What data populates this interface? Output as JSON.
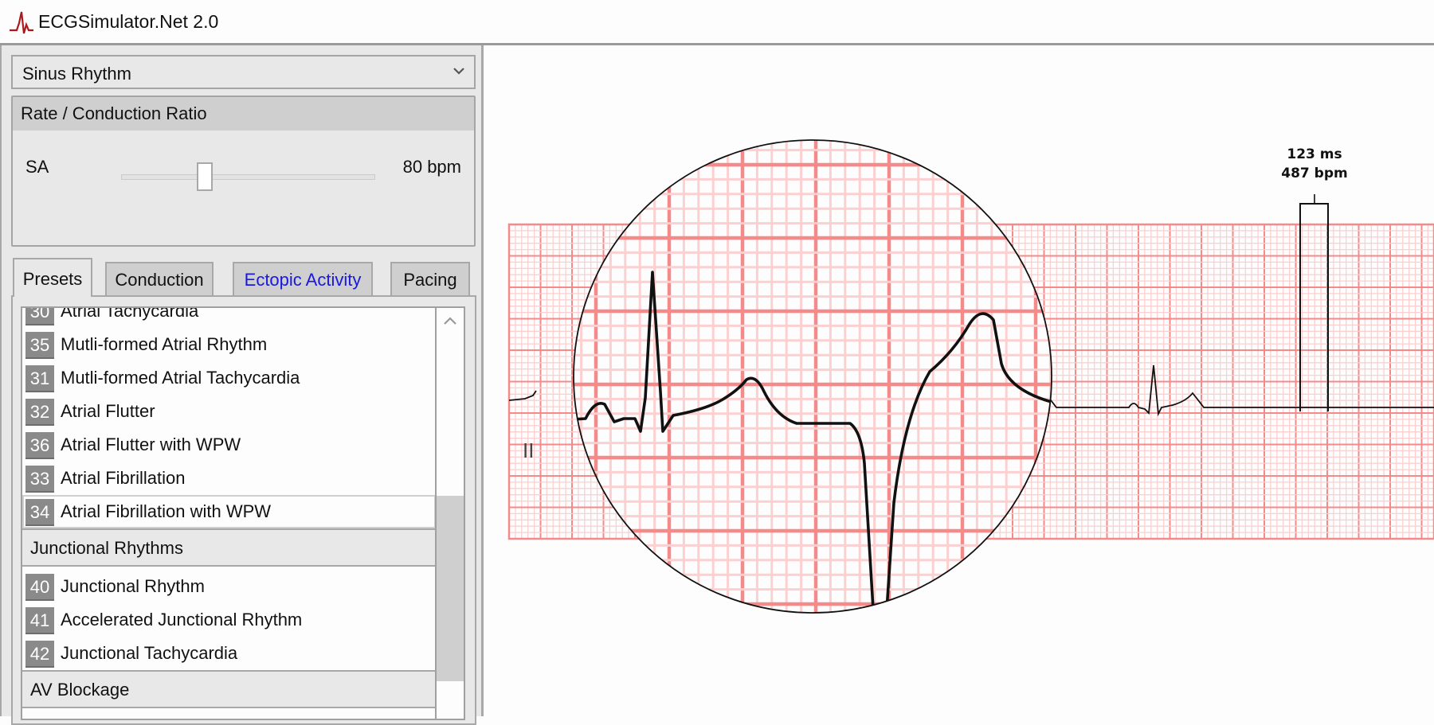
{
  "app": {
    "title": "ECGSimulator.Net 2.0",
    "logo_icon": "ecg-pulse-icon",
    "logo_color": "#b01818"
  },
  "rhythm_select": {
    "value": "Sinus Rhythm",
    "icon": "chevron-down-icon"
  },
  "rate_panel": {
    "header": "Rate / Conduction Ratio",
    "sa_label": "SA",
    "sa_value": "80 bpm",
    "sa_slider_fraction": 0.33
  },
  "tabs": [
    {
      "label": "Presets",
      "active": true
    },
    {
      "label": "Conduction",
      "active": false
    },
    {
      "label": "Ectopic Activity",
      "active": false,
      "color": "#1818e0"
    },
    {
      "label": "Pacing",
      "active": false
    }
  ],
  "presets": {
    "groups": [
      {
        "items": [
          {
            "num": "30",
            "label": "Atrial Tachycardia"
          },
          {
            "num": "35",
            "label": "Mutli-formed Atrial Rhythm"
          },
          {
            "num": "31",
            "label": "Mutli-formed Atrial Tachycardia"
          },
          {
            "num": "32",
            "label": "Atrial Flutter"
          },
          {
            "num": "36",
            "label": "Atrial Flutter with WPW"
          },
          {
            "num": "33",
            "label": "Atrial Fibrillation"
          },
          {
            "num": "34",
            "label": "Atrial Fibrillation with WPW",
            "selected": true
          }
        ]
      },
      {
        "header": "Junctional Rhythms",
        "items": [
          {
            "num": "40",
            "label": "Junctional Rhythm"
          },
          {
            "num": "41",
            "label": "Accelerated Junctional Rhythm"
          },
          {
            "num": "42",
            "label": "Junctional Tachycardia"
          }
        ]
      },
      {
        "header": "AV Blockage",
        "items": []
      }
    ],
    "scroll_up_icon": "chevron-up-icon"
  },
  "ecg": {
    "lead_label": "II",
    "caliper": {
      "interval": "123 ms",
      "rate": "487 bpm"
    },
    "grid_major_color": "#f48a8a",
    "grid_minor_color": "#fcd0d0",
    "trace_color": "#111111",
    "magnifier": true
  }
}
